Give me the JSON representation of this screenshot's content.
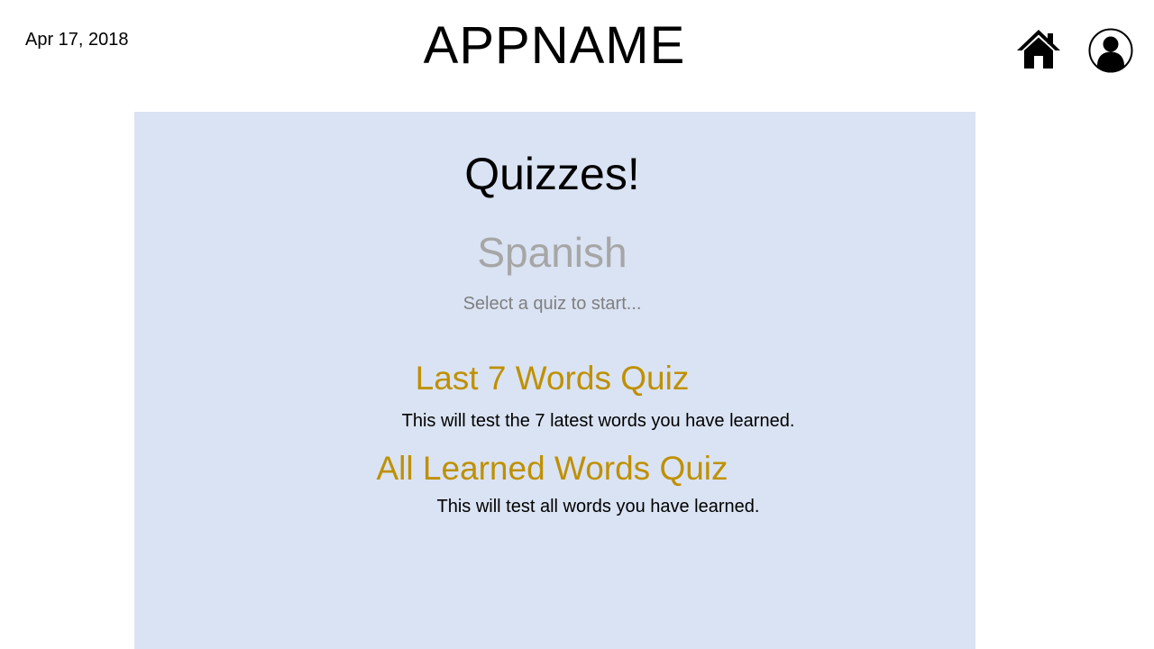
{
  "header": {
    "date": "Apr 17, 2018",
    "app_title": "APPNAME",
    "home_icon": "home-icon",
    "profile_icon": "user-profile-icon"
  },
  "main": {
    "title": "Quizzes!",
    "language": "Spanish",
    "hint": "Select a quiz to start...",
    "quizzes": [
      {
        "title": "Last 7 Words Quiz",
        "description": "This will test the 7 latest words you have learned."
      },
      {
        "title": "All Learned Words Quiz",
        "description": "This will test all words you have learned."
      }
    ]
  },
  "colors": {
    "panel_background": "#dae3f3",
    "quiz_link": "#bf9000",
    "language_text": "#a6a6a6",
    "hint_text": "#7f7f7f"
  }
}
